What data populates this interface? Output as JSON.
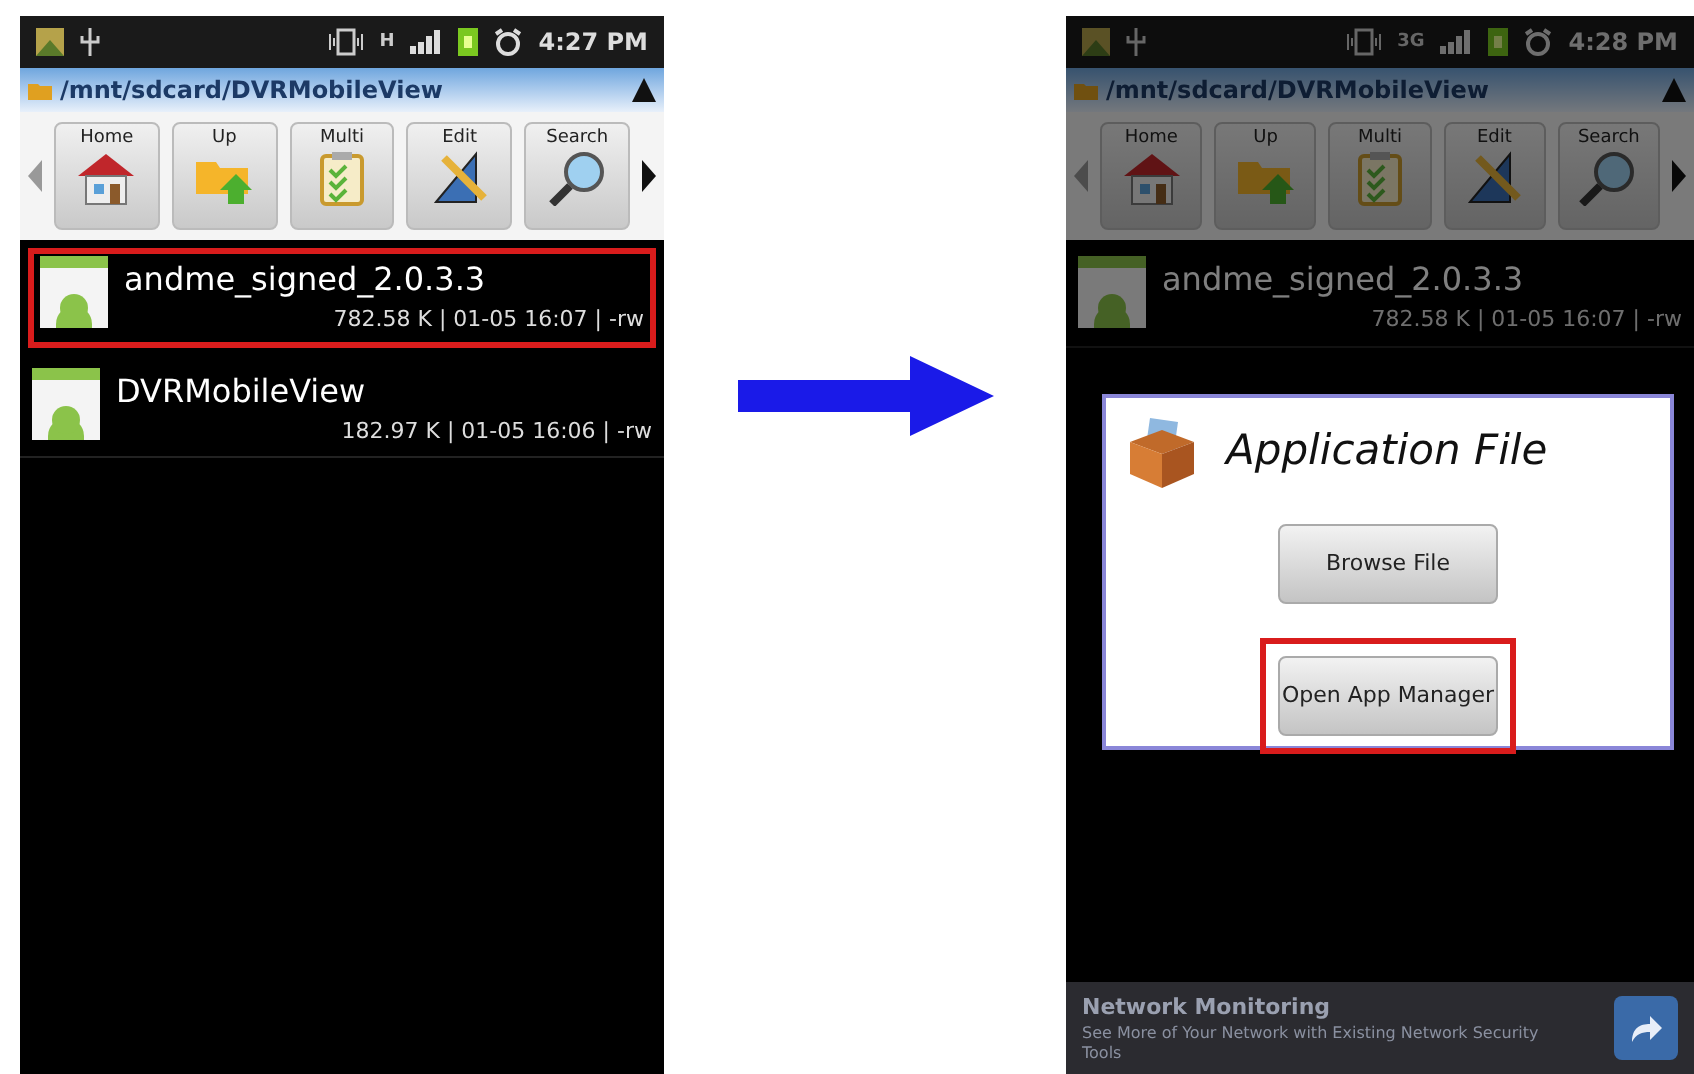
{
  "screens": [
    {
      "status_bar": {
        "network": "H",
        "time": "4:27 PM"
      },
      "path": "/mnt/sdcard/DVRMobileView",
      "dimmed": false,
      "toolbar": [
        {
          "label": "Home",
          "kind": "home"
        },
        {
          "label": "Up",
          "kind": "up"
        },
        {
          "label": "Multi",
          "kind": "multi"
        },
        {
          "label": "Edit",
          "kind": "edit"
        },
        {
          "label": "Search",
          "kind": "search"
        }
      ],
      "files": [
        {
          "name": "andme_signed_2.0.3.3",
          "meta": "782.58 K | 01-05 16:07 | -rw",
          "highlighted": true
        },
        {
          "name": "DVRMobileView",
          "meta": "182.97 K | 01-05 16:06 | -rw",
          "highlighted": false
        }
      ]
    },
    {
      "status_bar": {
        "network": "3G",
        "time": "4:28 PM"
      },
      "path": "/mnt/sdcard/DVRMobileView",
      "dimmed": true,
      "toolbar": [
        {
          "label": "Home",
          "kind": "home"
        },
        {
          "label": "Up",
          "kind": "up"
        },
        {
          "label": "Multi",
          "kind": "multi"
        },
        {
          "label": "Edit",
          "kind": "edit"
        },
        {
          "label": "Search",
          "kind": "search"
        }
      ],
      "files": [
        {
          "name": "andme_signed_2.0.3.3",
          "meta": "782.58 K | 01-05 16:07 | -rw",
          "highlighted": false
        }
      ],
      "dialog": {
        "title": "Application File",
        "buttons": [
          {
            "label": "Browse File",
            "highlighted": false
          },
          {
            "label": "Open App Manager",
            "highlighted": true
          }
        ]
      },
      "banner": {
        "title": "Network Monitoring",
        "text": "See More of Your Network with Existing Network Security Tools"
      }
    }
  ]
}
